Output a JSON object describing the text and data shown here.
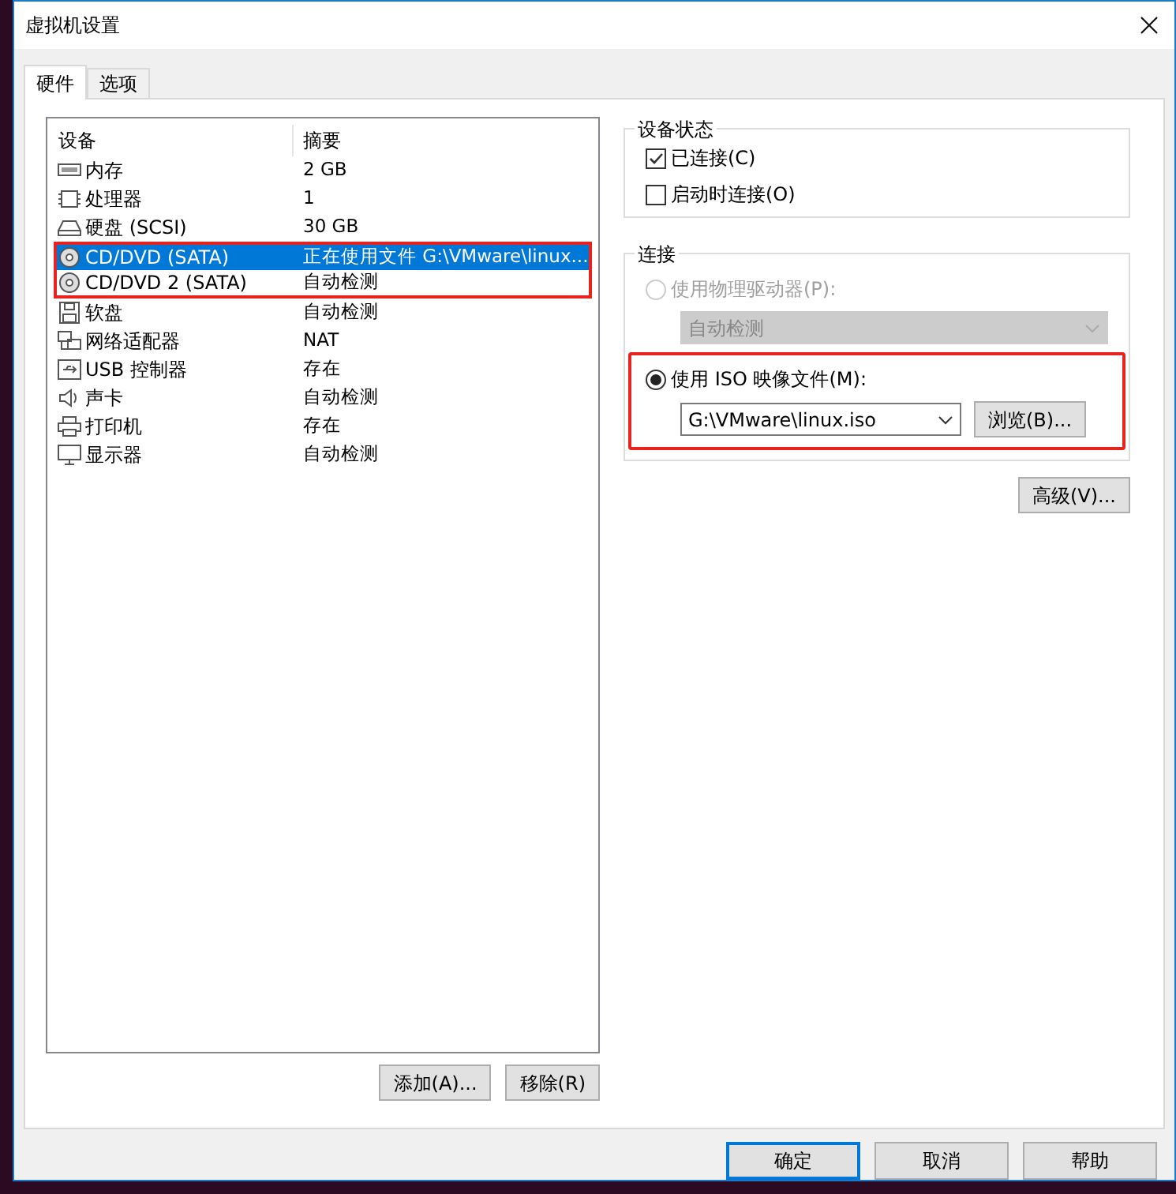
{
  "window": {
    "title": "虚拟机设置"
  },
  "tabs": [
    {
      "label": "硬件",
      "selected": true
    },
    {
      "label": "选项",
      "selected": false
    }
  ],
  "device_table": {
    "columns": [
      "设备",
      "摘要"
    ],
    "rows": [
      {
        "kind": "memory",
        "device": "内存",
        "summary": "2 GB",
        "selected": false,
        "highlighted": false
      },
      {
        "kind": "cpu",
        "device": "处理器",
        "summary": "1",
        "selected": false,
        "highlighted": false
      },
      {
        "kind": "disk",
        "device": "硬盘 (SCSI)",
        "summary": "30 GB",
        "selected": false,
        "highlighted": false
      },
      {
        "kind": "cd",
        "device": "CD/DVD (SATA)",
        "summary": "正在使用文件 G:\\VMware\\linux...",
        "selected": true,
        "highlighted": true
      },
      {
        "kind": "cd",
        "device": "CD/DVD 2 (SATA)",
        "summary": "自动检测",
        "selected": false,
        "highlighted": true
      },
      {
        "kind": "floppy",
        "device": "软盘",
        "summary": "自动检测",
        "selected": false,
        "highlighted": false
      },
      {
        "kind": "network",
        "device": "网络适配器",
        "summary": "NAT",
        "selected": false,
        "highlighted": false
      },
      {
        "kind": "usb",
        "device": "USB 控制器",
        "summary": "存在",
        "selected": false,
        "highlighted": false
      },
      {
        "kind": "sound",
        "device": "声卡",
        "summary": "自动检测",
        "selected": false,
        "highlighted": false
      },
      {
        "kind": "printer",
        "device": "打印机",
        "summary": "存在",
        "selected": false,
        "highlighted": false
      },
      {
        "kind": "display",
        "device": "显示器",
        "summary": "自动检测",
        "selected": false,
        "highlighted": false
      }
    ]
  },
  "list_buttons": [
    "添加(A)...",
    "移除(R)"
  ],
  "device_status": {
    "title": "设备状态",
    "options": [
      {
        "label": "已连接(C)",
        "checked": true
      },
      {
        "label": "启动时连接(O)",
        "checked": false
      }
    ]
  },
  "connection": {
    "title": "连接",
    "options": [
      {
        "label": "使用物理驱动器(P):",
        "selected": false,
        "disabled": true,
        "dropdown": "自动检测"
      },
      {
        "label": "使用 ISO 映像文件(M):",
        "selected": true,
        "disabled": false,
        "dropdown": "G:\\VMware\\linux.iso",
        "browse_button": "浏览(B)...",
        "highlighted": true
      }
    ]
  },
  "advanced_button": "高级(V)...",
  "dialog_buttons": [
    {
      "label": "确定",
      "default": true
    },
    {
      "label": "取消",
      "default": false
    },
    {
      "label": "帮助",
      "default": false
    }
  ]
}
